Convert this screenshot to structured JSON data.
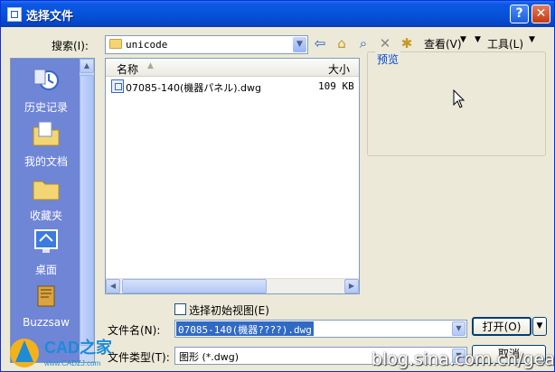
{
  "window": {
    "title": "选择文件"
  },
  "toolbar": {
    "search_label": "搜索(I):",
    "location": "unicode",
    "view_label": "查看(V)",
    "tools_label": "工具(L)"
  },
  "places": [
    {
      "label": "历史记录"
    },
    {
      "label": "我的文档"
    },
    {
      "label": "收藏夹"
    },
    {
      "label": "桌面"
    },
    {
      "label": "Buzzsaw"
    }
  ],
  "filelist": {
    "columns": [
      "名称",
      "大小"
    ],
    "rows": [
      {
        "name": "07085-140(機器パネル).dwg",
        "size": "109 KB"
      }
    ]
  },
  "preview": {
    "label": "预览"
  },
  "options": {
    "initial_view_label": "选择初始视图(E)"
  },
  "form": {
    "filename_label": "文件名(N):",
    "filename_value": "07085-140(機器????).dwg",
    "filetype_label": "文件类型(T):",
    "filetype_value": "图形 (*.dwg)"
  },
  "buttons": {
    "open": "打开(O)",
    "cancel": "取消"
  },
  "watermark": {
    "site": "blog.sina.com.cn/gead",
    "logo_text": "CAD之家",
    "logo_url": "www.CADZJ.com"
  }
}
